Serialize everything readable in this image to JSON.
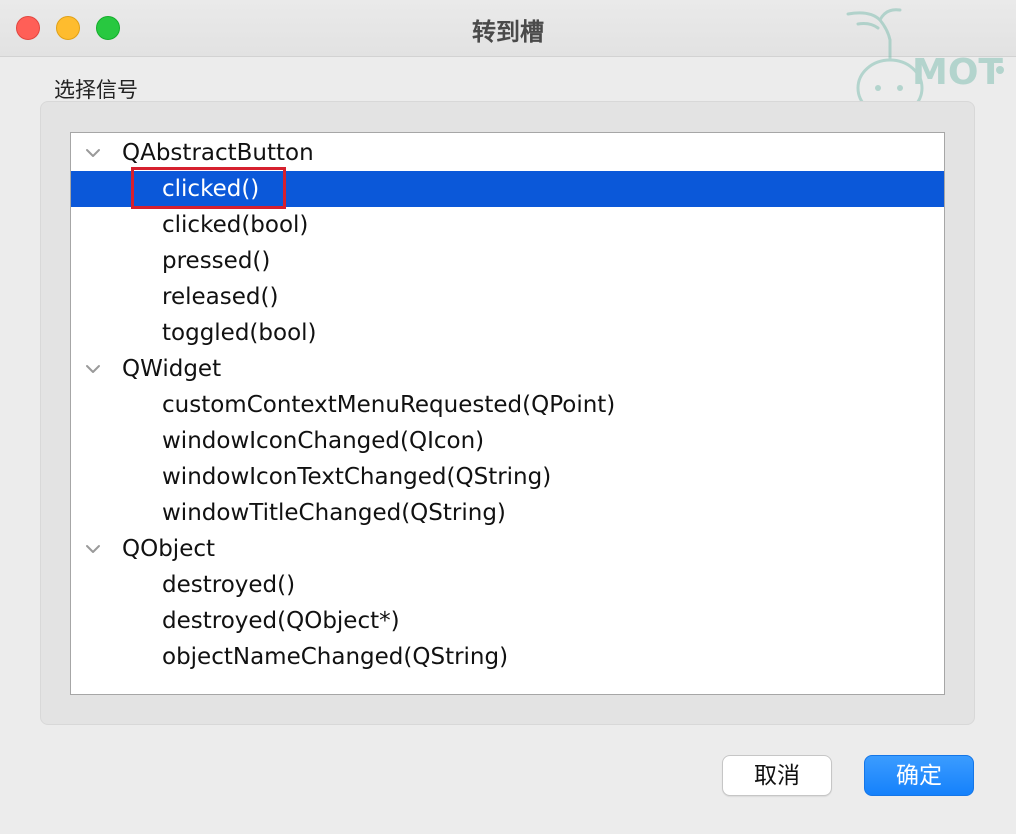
{
  "window": {
    "title": "转到槽"
  },
  "group_label": "选择信号",
  "tree": {
    "rows": [
      {
        "text": "QAbstractButton",
        "kind": "group",
        "expanded": true
      },
      {
        "text": "clicked()",
        "kind": "signal",
        "selected": true
      },
      {
        "text": "clicked(bool)",
        "kind": "signal"
      },
      {
        "text": "pressed()",
        "kind": "signal"
      },
      {
        "text": "released()",
        "kind": "signal"
      },
      {
        "text": "toggled(bool)",
        "kind": "signal"
      },
      {
        "text": "QWidget",
        "kind": "group",
        "expanded": true
      },
      {
        "text": "customContextMenuRequested(QPoint)",
        "kind": "signal"
      },
      {
        "text": "windowIconChanged(QIcon)",
        "kind": "signal"
      },
      {
        "text": "windowIconTextChanged(QString)",
        "kind": "signal"
      },
      {
        "text": "windowTitleChanged(QString)",
        "kind": "signal"
      },
      {
        "text": "QObject",
        "kind": "group",
        "expanded": true
      },
      {
        "text": "destroyed()",
        "kind": "signal"
      },
      {
        "text": "destroyed(QObject*)",
        "kind": "signal"
      },
      {
        "text": "objectNameChanged(QString)",
        "kind": "signal"
      }
    ]
  },
  "buttons": {
    "cancel": "取消",
    "ok": "确定"
  },
  "watermark": {
    "text": "MOT"
  },
  "colors": {
    "selection": "#0b58d9",
    "highlight_border": "#d6202e",
    "primary_button": "#1581fb"
  }
}
